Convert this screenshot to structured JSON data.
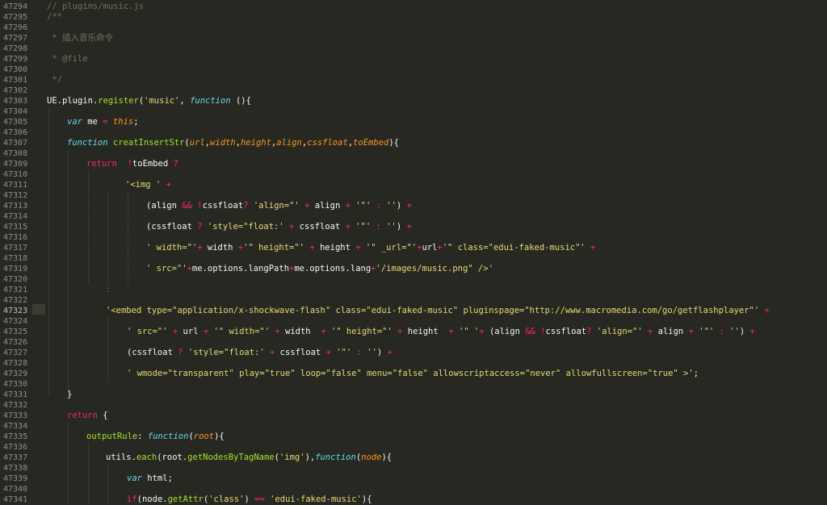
{
  "theme": {
    "background": "#272822",
    "gutter_text": "#8f908a",
    "comment": "#75715e",
    "keyword": "#66d9ef",
    "operator": "#f92672",
    "function": "#a6e22e",
    "string": "#e6db74",
    "param": "#fd971f",
    "text": "#f8f8f2",
    "line_highlight": "#3e3d32"
  },
  "editor": {
    "active_line": "47323",
    "lines": [
      {
        "n": "47294",
        "t": [
          [
            "cm",
            "// plugins/music.js"
          ]
        ]
      },
      {
        "n": "47295",
        "t": [
          [
            "cm",
            "/**"
          ]
        ]
      },
      {
        "n": "47296",
        "t": []
      },
      {
        "n": "47297",
        "t": [
          [
            "cm",
            " * 插入音乐命令"
          ]
        ]
      },
      {
        "n": "47298",
        "t": []
      },
      {
        "n": "47299",
        "t": [
          [
            "cm",
            " * @file"
          ]
        ]
      },
      {
        "n": "47300",
        "t": []
      },
      {
        "n": "47301",
        "t": [
          [
            "cm",
            " */"
          ]
        ]
      },
      {
        "n": "47302",
        "t": []
      },
      {
        "n": "47303",
        "t": [
          [
            "tx",
            "UE"
          ],
          [
            "tx",
            "."
          ],
          [
            "tx",
            "plugin"
          ],
          [
            "tx",
            "."
          ],
          [
            "fn",
            "register"
          ],
          [
            "tx",
            "("
          ],
          [
            "str",
            "'music'"
          ],
          [
            "tx",
            ", "
          ],
          [
            "kw",
            "function"
          ],
          [
            "tx",
            " (){"
          ]
        ]
      },
      {
        "n": "47304",
        "t": []
      },
      {
        "n": "47305",
        "t": [
          [
            "kw",
            "var"
          ],
          [
            "tx",
            " me "
          ],
          [
            "op",
            "="
          ],
          [
            "tx",
            " "
          ],
          [
            "pm",
            "this"
          ],
          [
            "tx",
            ";"
          ]
        ]
      },
      {
        "n": "47306",
        "t": []
      },
      {
        "n": "47307",
        "t": [
          [
            "kw",
            "function"
          ],
          [
            "tx",
            " "
          ],
          [
            "fn",
            "creatInsertStr"
          ],
          [
            "tx",
            "("
          ],
          [
            "pm",
            "url"
          ],
          [
            "tx",
            ","
          ],
          [
            "pm",
            "width"
          ],
          [
            "tx",
            ","
          ],
          [
            "pm",
            "height"
          ],
          [
            "tx",
            ","
          ],
          [
            "pm",
            "align"
          ],
          [
            "tx",
            ","
          ],
          [
            "pm",
            "cssfloat"
          ],
          [
            "tx",
            ","
          ],
          [
            "pm",
            "toEmbed"
          ],
          [
            "tx",
            "){"
          ]
        ]
      },
      {
        "n": "47308",
        "t": []
      },
      {
        "n": "47309",
        "t": [
          [
            "rt",
            "return"
          ],
          [
            "tx",
            "  "
          ],
          [
            "op",
            "!"
          ],
          [
            "tx",
            "toEmbed "
          ],
          [
            "op",
            "?"
          ]
        ]
      },
      {
        "n": "47310",
        "t": []
      },
      {
        "n": "47311",
        "t": [
          [
            "str",
            "'<img '"
          ],
          [
            "tx",
            " "
          ],
          [
            "op",
            "+"
          ]
        ]
      },
      {
        "n": "47312",
        "t": []
      },
      {
        "n": "47313",
        "t": [
          [
            "tx",
            "(align "
          ],
          [
            "op",
            "&&"
          ],
          [
            "tx",
            " "
          ],
          [
            "op",
            "!"
          ],
          [
            "tx",
            "cssfloat"
          ],
          [
            "op",
            "?"
          ],
          [
            "tx",
            " "
          ],
          [
            "str",
            "'align=\"'"
          ],
          [
            "tx",
            " "
          ],
          [
            "op",
            "+"
          ],
          [
            "tx",
            " align "
          ],
          [
            "op",
            "+"
          ],
          [
            "tx",
            " "
          ],
          [
            "str",
            "'\"'"
          ],
          [
            "tx",
            " "
          ],
          [
            "op",
            ":"
          ],
          [
            "tx",
            " "
          ],
          [
            "str",
            "''"
          ],
          [
            "tx",
            ") "
          ],
          [
            "op",
            "+"
          ]
        ]
      },
      {
        "n": "47314",
        "t": []
      },
      {
        "n": "47315",
        "t": [
          [
            "tx",
            "(cssfloat "
          ],
          [
            "op",
            "?"
          ],
          [
            "tx",
            " "
          ],
          [
            "str",
            "'style=\"float:'"
          ],
          [
            "tx",
            " "
          ],
          [
            "op",
            "+"
          ],
          [
            "tx",
            " cssfloat "
          ],
          [
            "op",
            "+"
          ],
          [
            "tx",
            " "
          ],
          [
            "str",
            "'\"'"
          ],
          [
            "tx",
            " "
          ],
          [
            "op",
            ":"
          ],
          [
            "tx",
            " "
          ],
          [
            "str",
            "''"
          ],
          [
            "tx",
            ") "
          ],
          [
            "op",
            "+"
          ]
        ]
      },
      {
        "n": "47316",
        "t": []
      },
      {
        "n": "47317",
        "t": [
          [
            "str",
            "' width=\"'"
          ],
          [
            "op",
            "+"
          ],
          [
            "tx",
            " width "
          ],
          [
            "op",
            "+"
          ],
          [
            "str",
            "'\" height=\"'"
          ],
          [
            "tx",
            " "
          ],
          [
            "op",
            "+"
          ],
          [
            "tx",
            " height "
          ],
          [
            "op",
            "+"
          ],
          [
            "tx",
            " "
          ],
          [
            "str",
            "'\" _url=\"'"
          ],
          [
            "op",
            "+"
          ],
          [
            "tx",
            "url"
          ],
          [
            "op",
            "+"
          ],
          [
            "str",
            "'\" class=\"edui-faked-music\"'"
          ],
          [
            "tx",
            " "
          ],
          [
            "op",
            "+"
          ]
        ]
      },
      {
        "n": "47318",
        "t": []
      },
      {
        "n": "47319",
        "t": [
          [
            "str",
            "' src=\"'"
          ],
          [
            "op",
            "+"
          ],
          [
            "tx",
            "me.options.langPath"
          ],
          [
            "op",
            "+"
          ],
          [
            "tx",
            "me.options.lang"
          ],
          [
            "op",
            "+"
          ],
          [
            "str",
            "'/images/music.png\" />'"
          ]
        ]
      },
      {
        "n": "47320",
        "t": []
      },
      {
        "n": "47321",
        "t": [
          [
            "op",
            ":"
          ]
        ]
      },
      {
        "n": "47322",
        "t": []
      },
      {
        "n": "47323",
        "t": [
          [
            "str",
            "'<embed type=\"application/x-shockwave-flash\" class=\"edui-faked-music\" pluginspage=\"http://www.macromedia.com/go/getflashplayer\"'"
          ],
          [
            "tx",
            " "
          ],
          [
            "op",
            "+"
          ]
        ]
      },
      {
        "n": "47324",
        "t": []
      },
      {
        "n": "47325",
        "t": [
          [
            "str",
            "' src=\"'"
          ],
          [
            "tx",
            " "
          ],
          [
            "op",
            "+"
          ],
          [
            "tx",
            " url "
          ],
          [
            "op",
            "+"
          ],
          [
            "tx",
            " "
          ],
          [
            "str",
            "'\" width=\"'"
          ],
          [
            "tx",
            " "
          ],
          [
            "op",
            "+"
          ],
          [
            "tx",
            " width  "
          ],
          [
            "op",
            "+"
          ],
          [
            "tx",
            " "
          ],
          [
            "str",
            "'\" height=\"'"
          ],
          [
            "tx",
            " "
          ],
          [
            "op",
            "+"
          ],
          [
            "tx",
            " height  "
          ],
          [
            "op",
            "+"
          ],
          [
            "tx",
            " "
          ],
          [
            "str",
            "'\" '"
          ],
          [
            "op",
            "+"
          ],
          [
            "tx",
            " (align "
          ],
          [
            "op",
            "&&"
          ],
          [
            "tx",
            " "
          ],
          [
            "op",
            "!"
          ],
          [
            "tx",
            "cssfloat"
          ],
          [
            "op",
            "?"
          ],
          [
            "tx",
            " "
          ],
          [
            "str",
            "'align=\"'"
          ],
          [
            "tx",
            " "
          ],
          [
            "op",
            "+"
          ],
          [
            "tx",
            " align "
          ],
          [
            "op",
            "+"
          ],
          [
            "tx",
            " "
          ],
          [
            "str",
            "'\"'"
          ],
          [
            "tx",
            " "
          ],
          [
            "op",
            ":"
          ],
          [
            "tx",
            " "
          ],
          [
            "str",
            "''"
          ],
          [
            "tx",
            ") "
          ],
          [
            "op",
            "+"
          ]
        ]
      },
      {
        "n": "47326",
        "t": []
      },
      {
        "n": "47327",
        "t": [
          [
            "tx",
            "(cssfloat "
          ],
          [
            "op",
            "?"
          ],
          [
            "tx",
            " "
          ],
          [
            "str",
            "'style=\"float:'"
          ],
          [
            "tx",
            " "
          ],
          [
            "op",
            "+"
          ],
          [
            "tx",
            " cssfloat "
          ],
          [
            "op",
            "+"
          ],
          [
            "tx",
            " "
          ],
          [
            "str",
            "'\"'"
          ],
          [
            "tx",
            " "
          ],
          [
            "op",
            ":"
          ],
          [
            "tx",
            " "
          ],
          [
            "str",
            "''"
          ],
          [
            "tx",
            ") "
          ],
          [
            "op",
            "+"
          ]
        ]
      },
      {
        "n": "47328",
        "t": []
      },
      {
        "n": "47329",
        "t": [
          [
            "str",
            "' wmode=\"transparent\" play=\"true\" loop=\"false\" menu=\"false\" allowscriptaccess=\"never\" allowfullscreen=\"true\" >'"
          ],
          [
            "tx",
            ";"
          ]
        ]
      },
      {
        "n": "47330",
        "t": []
      },
      {
        "n": "47331",
        "t": [
          [
            "tx",
            "}"
          ]
        ]
      },
      {
        "n": "47332",
        "t": []
      },
      {
        "n": "47333",
        "t": [
          [
            "rt",
            "return"
          ],
          [
            "tx",
            " {"
          ]
        ]
      },
      {
        "n": "47334",
        "t": []
      },
      {
        "n": "47335",
        "t": [
          [
            "fn",
            "outputRule"
          ],
          [
            "tx",
            ": "
          ],
          [
            "kw",
            "function"
          ],
          [
            "tx",
            "("
          ],
          [
            "pm",
            "root"
          ],
          [
            "tx",
            "){"
          ]
        ]
      },
      {
        "n": "47336",
        "t": []
      },
      {
        "n": "47337",
        "t": [
          [
            "tx",
            "utils."
          ],
          [
            "fn",
            "each"
          ],
          [
            "tx",
            "(root."
          ],
          [
            "fn",
            "getNodesByTagName"
          ],
          [
            "tx",
            "("
          ],
          [
            "str",
            "'img'"
          ],
          [
            "tx",
            "),"
          ],
          [
            "kw",
            "function"
          ],
          [
            "tx",
            "("
          ],
          [
            "pm",
            "node"
          ],
          [
            "tx",
            "){"
          ]
        ]
      },
      {
        "n": "47338",
        "t": []
      },
      {
        "n": "47339",
        "t": [
          [
            "kw",
            "var"
          ],
          [
            "tx",
            " html;"
          ]
        ]
      },
      {
        "n": "47340",
        "t": []
      },
      {
        "n": "47341",
        "t": [
          [
            "rt",
            "if"
          ],
          [
            "tx",
            "(node."
          ],
          [
            "fn",
            "getAttr"
          ],
          [
            "tx",
            "("
          ],
          [
            "str",
            "'class'"
          ],
          [
            "tx",
            ") "
          ],
          [
            "op",
            "=="
          ],
          [
            "tx",
            " "
          ],
          [
            "str",
            "'edui-faked-music'"
          ],
          [
            "tx",
            "){"
          ]
        ]
      }
    ]
  }
}
